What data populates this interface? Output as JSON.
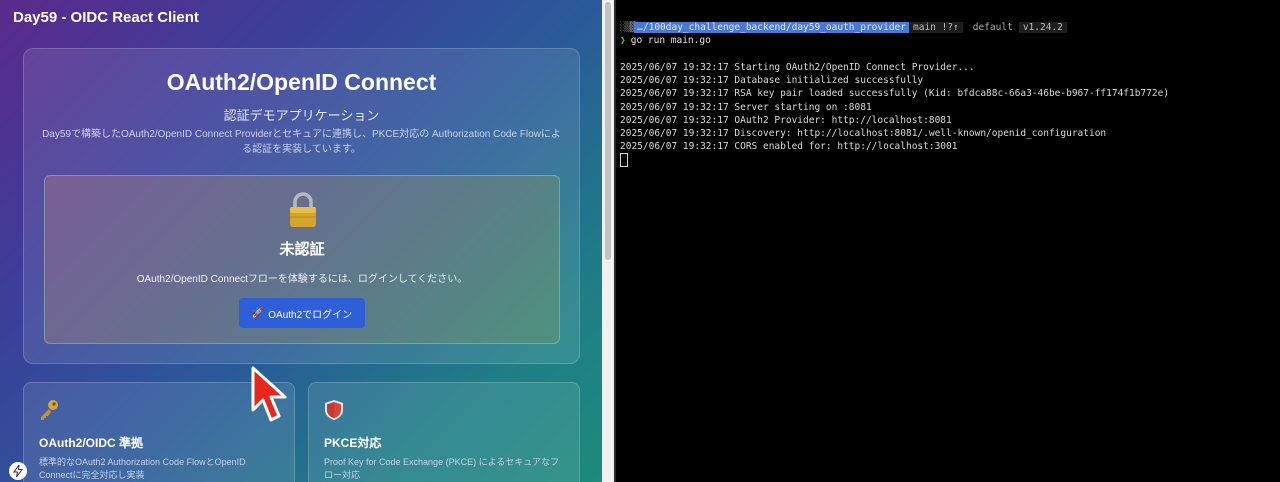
{
  "app": {
    "title": "Day59 - OIDC React Client",
    "hero": {
      "title": "OAuth2/OpenID Connect",
      "subtitle": "認証デモアプリケーション",
      "description": "Day59で構築したOAuth2/OpenID Connect Providerとセキュアに連携し、PKCE対応の Authorization Code Flowによる認証を実装しています。"
    },
    "auth": {
      "status": "未認証",
      "description": "OAuth2/OpenID Connectフローを体験するには、ログインしてください。",
      "login_label": "OAuth2でログイン",
      "login_icon": "🚀"
    },
    "features": [
      {
        "icon": "key-icon",
        "title": "OAuth2/OIDC 準拠",
        "description": "標準的なOAuth2 Authorization Code FlowとOpenID Connectに完全対応し実装"
      },
      {
        "icon": "shield-icon",
        "title": "PKCE対応",
        "description": "Proof Key for Code Exchange (PKCE) によるセキュアなフロー対応"
      }
    ]
  },
  "terminal": {
    "prompt": {
      "dots": "░▒▓",
      "path": "…/100day_challenge_backend/day59_oauth_provider",
      "git": "main !?↑",
      "context": "default",
      "version": "v1.24.2"
    },
    "command": "go run main.go",
    "log": [
      "2025/06/07 19:32:17 Starting OAuth2/OpenID Connect Provider...",
      "2025/06/07 19:32:17 Database initialized successfully",
      "2025/06/07 19:32:17 RSA key pair loaded successfully (Kid: bfdca88c-66a3-46be-b967-ff174f1b772e)",
      "2025/06/07 19:32:17 Server starting on :8081",
      "2025/06/07 19:32:17 OAuth2 Provider: http://localhost:8081",
      "2025/06/07 19:32:17 Discovery: http://localhost:8081/.well-known/openid_configuration",
      "2025/06/07 19:32:17 CORS enabled for: http://localhost:3001"
    ]
  }
}
